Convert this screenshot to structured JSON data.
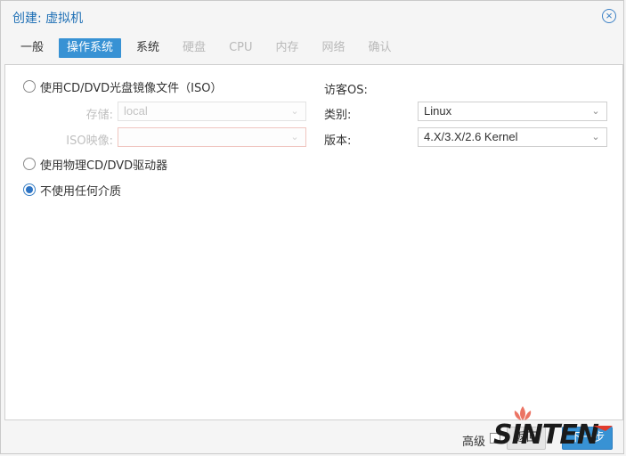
{
  "dialog": {
    "title": "创建: 虚拟机",
    "close_icon": "close-circle-icon"
  },
  "tabs": [
    {
      "label": "一般",
      "state": "done"
    },
    {
      "label": "操作系统",
      "state": "active"
    },
    {
      "label": "系统",
      "state": "done"
    },
    {
      "label": "硬盘",
      "state": "disabled"
    },
    {
      "label": "CPU",
      "state": "disabled"
    },
    {
      "label": "内存",
      "state": "disabled"
    },
    {
      "label": "网络",
      "state": "disabled"
    },
    {
      "label": "确认",
      "state": "disabled"
    }
  ],
  "media": {
    "option_iso": "使用CD/DVD光盘镜像文件（ISO）",
    "storage_label": "存储:",
    "storage_value": "local",
    "iso_label": "ISO映像:",
    "iso_value": "",
    "option_physical": "使用物理CD/DVD驱动器",
    "option_none": "不使用任何介质",
    "selected": "option_none"
  },
  "guest_os": {
    "heading": "访客OS:",
    "type_label": "类别:",
    "type_value": "Linux",
    "version_label": "版本:",
    "version_value": "4.X/3.X/2.6 Kernel"
  },
  "footer": {
    "advanced_label": "高级",
    "advanced_checked": false,
    "back_label": "返回",
    "next_label": "下一步"
  },
  "watermark": {
    "text": "SINTEN"
  },
  "colors": {
    "accent": "#3892d4",
    "title": "#1e6fb5",
    "disabled_text": "#b9b9b9"
  }
}
